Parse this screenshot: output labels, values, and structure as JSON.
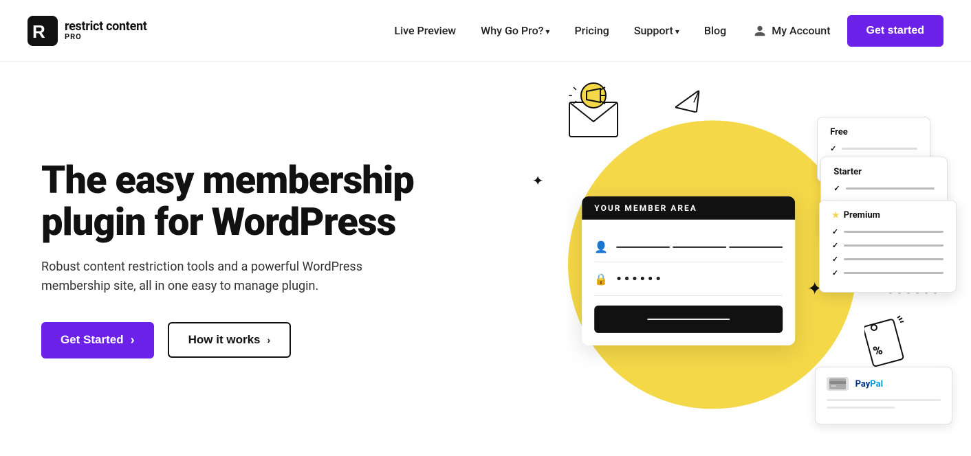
{
  "logo": {
    "icon_alt": "R logo",
    "brand": "restrict content",
    "pro_label": "PRO"
  },
  "nav": {
    "links": [
      {
        "label": "Live Preview",
        "has_arrow": false
      },
      {
        "label": "Why Go Pro?",
        "has_arrow": true
      },
      {
        "label": "Pricing",
        "has_arrow": false
      },
      {
        "label": "Support",
        "has_arrow": true
      },
      {
        "label": "Blog",
        "has_arrow": false
      }
    ],
    "account_label": "My Account",
    "cta_label": "Get started"
  },
  "hero": {
    "title": "The easy membership plugin for WordPress",
    "subtitle": "Robust content restriction tools and a powerful WordPress membership site, all in one easy to manage plugin.",
    "btn_primary": "Get Started",
    "btn_primary_arrow": "›",
    "btn_secondary": "How it works",
    "btn_secondary_arrow": "›"
  },
  "illustration": {
    "member_area_header": "YOUR MEMBER AREA",
    "member_password_dots": "••••••",
    "tier_free_label": "Free",
    "tier_starter_label": "Starter",
    "tier_premium_label": "Premium",
    "paypal_label": "PayPal"
  }
}
